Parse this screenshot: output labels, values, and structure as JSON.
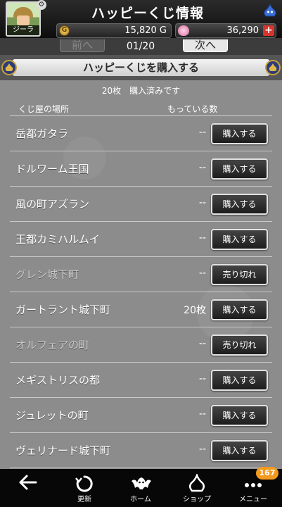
{
  "header": {
    "title": "ハッピーくじ情報",
    "player_name": "ジーラ",
    "gold": "15,820 G",
    "gems": "36,290",
    "plus_label": "+"
  },
  "pager": {
    "prev_label": "前へ",
    "next_label": "次へ",
    "count": "01/20"
  },
  "section": {
    "title": "ハッピーくじを購入する",
    "purchased_text": "20枚　購入済みです",
    "col_place": "くじ屋の場所",
    "col_owned": "もっている数"
  },
  "lottery_shops": [
    {
      "name": "岳都ガタラ",
      "owned": "--",
      "button": "購入する",
      "sold_out": false
    },
    {
      "name": "ドルワーム王国",
      "owned": "--",
      "button": "購入する",
      "sold_out": false
    },
    {
      "name": "風の町アズラン",
      "owned": "--",
      "button": "購入する",
      "sold_out": false
    },
    {
      "name": "王都カミハルムイ",
      "owned": "--",
      "button": "購入する",
      "sold_out": false
    },
    {
      "name": "グレン城下町",
      "owned": "--",
      "button": "売り切れ",
      "sold_out": true
    },
    {
      "name": "ガートラント城下町",
      "owned": "20枚",
      "button": "購入する",
      "sold_out": false
    },
    {
      "name": "オルフェアの町",
      "owned": "--",
      "button": "売り切れ",
      "sold_out": true
    },
    {
      "name": "メギストリスの都",
      "owned": "--",
      "button": "購入する",
      "sold_out": false
    },
    {
      "name": "ジュレットの町",
      "owned": "--",
      "button": "購入する",
      "sold_out": false
    },
    {
      "name": "ヴェリナード城下町",
      "owned": "--",
      "button": "購入する",
      "sold_out": false
    }
  ],
  "bottom_nav": [
    {
      "label": "",
      "icon": "back-arrow-icon"
    },
    {
      "label": "更新",
      "icon": "refresh-icon"
    },
    {
      "label": "ホーム",
      "icon": "home-bat-icon"
    },
    {
      "label": "ショップ",
      "icon": "slime-shop-icon"
    },
    {
      "label": "メニュー",
      "icon": "menu-dots-icon"
    }
  ],
  "menu_badge": "167",
  "colors": {
    "header_bg": "#1a1a1a",
    "list_bg": "#8c8c8c",
    "plus_red": "#d9342b",
    "badge_orange": "#f39a1e"
  }
}
